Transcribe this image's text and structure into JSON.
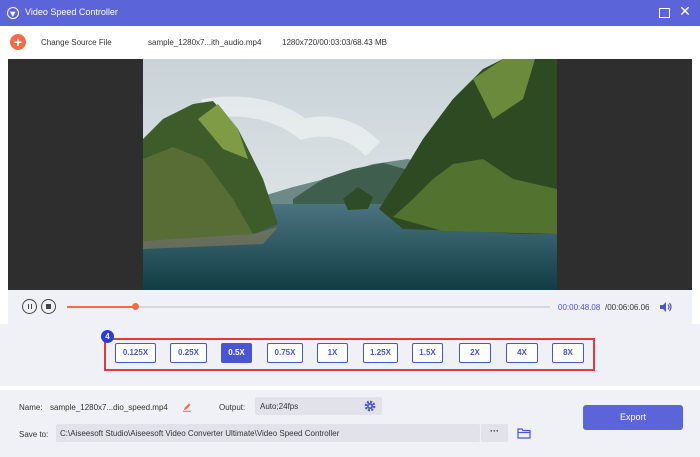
{
  "window": {
    "title": "Video Speed Controller"
  },
  "toolbar": {
    "change_source_label": "Change Source File",
    "file_name": "sample_1280x7...ith_audio.mp4",
    "file_info": "1280x720/00:03:03/68.43 MB"
  },
  "player": {
    "current_time": "00:00:48.08",
    "total_time": "/00:06:06.06",
    "progress": 0.14
  },
  "speed": {
    "step_badge": "4",
    "selected": "0.5X",
    "options": [
      "0.125X",
      "0.25X",
      "0.5X",
      "0.75X",
      "1X",
      "1.25X",
      "1.5X",
      "2X",
      "4X",
      "8X"
    ]
  },
  "output": {
    "name_label": "Name:",
    "name_value": "sample_1280x7...dio_speed.mp4",
    "output_label": "Output:",
    "output_value": "Auto;24fps",
    "save_label": "Save to:",
    "save_path": "C:\\Aiseesoft Studio\\Aiseesoft Video Converter Ultimate\\Video Speed Controller",
    "more_label": "···",
    "export_label": "Export"
  },
  "colors": {
    "accent": "#5b64d9",
    "progress": "#f26b4a",
    "highlight_border": "#e03a3a"
  }
}
